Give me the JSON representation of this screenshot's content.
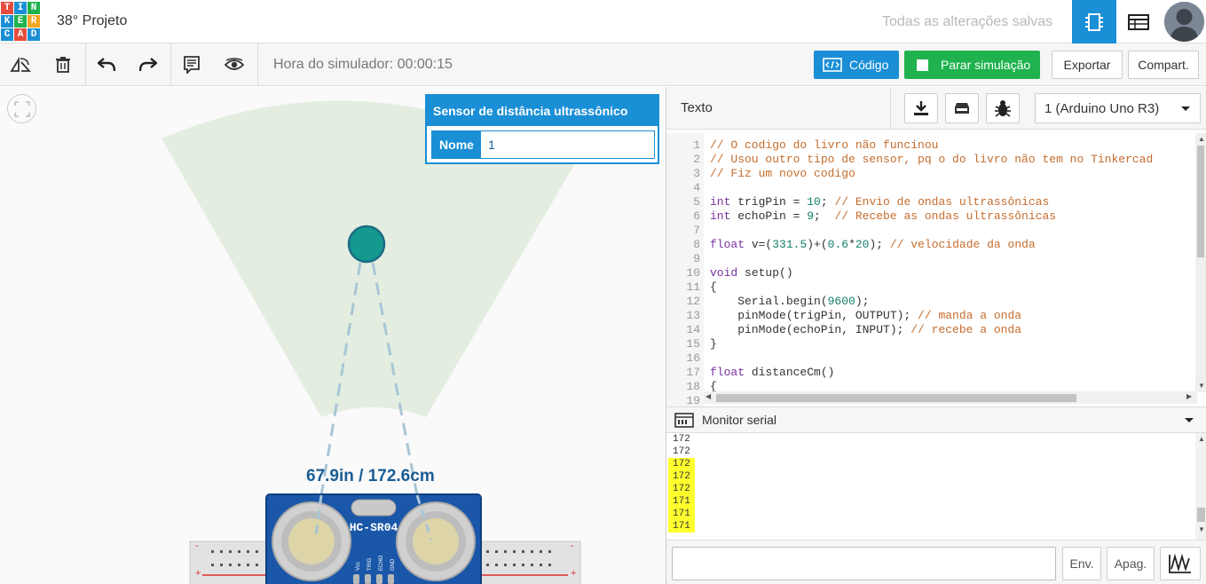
{
  "header": {
    "logo_letters": [
      "T",
      "I",
      "N",
      "K",
      "E",
      "R",
      "C",
      "A",
      "D"
    ],
    "project_title": "38° Projeto",
    "save_status": "Todas as alterações salvas",
    "circuit_view_icon": "circuit-chip-icon",
    "list_view_icon": "component-list-icon"
  },
  "toolbar": {
    "rotate_icon": "rotate-icon",
    "delete_icon": "trash-icon",
    "undo_icon": "undo-icon",
    "redo_icon": "redo-icon",
    "notes_icon": "notes-icon",
    "visibility_icon": "eye-icon",
    "simulator_time": "Hora do simulador: 00:00:15",
    "code_label": "Código",
    "stop_sim_label": "Parar simulação",
    "export_label": "Exportar",
    "share_label": "Compart."
  },
  "canvas": {
    "distance_readout": "67.9in / 172.6cm",
    "sensor_label": "HC-SR04",
    "pin_labels": [
      "Vcc",
      "TRIG",
      "ECHO",
      "GND"
    ],
    "inspector": {
      "title": "Sensor de distância ultrassônico",
      "name_label": "Nome",
      "name_value": "1"
    }
  },
  "code_panel": {
    "mode_label": "Texto",
    "download_icon": "download-icon",
    "library_icon": "library-icon",
    "debug_icon": "bug-icon",
    "board_selected": "1 (Arduino Uno R3)",
    "lines": [
      {
        "n": "1",
        "parts": [
          {
            "c": "cm",
            "t": "// O codigo do livro não funcinou"
          }
        ]
      },
      {
        "n": "2",
        "parts": [
          {
            "c": "cm",
            "t": "// Usou outro tipo de sensor, pq o do livro não tem no Tinkercad"
          }
        ]
      },
      {
        "n": "3",
        "parts": [
          {
            "c": "cm",
            "t": "// Fiz um novo codigo"
          }
        ]
      },
      {
        "n": "4",
        "parts": []
      },
      {
        "n": "5",
        "parts": [
          {
            "c": "kw",
            "t": "int"
          },
          {
            "c": "",
            "t": " trigPin = "
          },
          {
            "c": "nm",
            "t": "10"
          },
          {
            "c": "",
            "t": "; "
          },
          {
            "c": "cm",
            "t": "// Envio de ondas ultrassônicas"
          }
        ]
      },
      {
        "n": "6",
        "parts": [
          {
            "c": "kw",
            "t": "int"
          },
          {
            "c": "",
            "t": " echoPin = "
          },
          {
            "c": "nm",
            "t": "9"
          },
          {
            "c": "",
            "t": ";  "
          },
          {
            "c": "cm",
            "t": "// Recebe as ondas ultrassônicas"
          }
        ]
      },
      {
        "n": "7",
        "parts": []
      },
      {
        "n": "8",
        "parts": [
          {
            "c": "kw",
            "t": "float"
          },
          {
            "c": "",
            "t": " v=("
          },
          {
            "c": "nm",
            "t": "331.5"
          },
          {
            "c": "",
            "t": ")+("
          },
          {
            "c": "nm",
            "t": "0.6"
          },
          {
            "c": "",
            "t": "*"
          },
          {
            "c": "nm",
            "t": "20"
          },
          {
            "c": "",
            "t": "); "
          },
          {
            "c": "cm",
            "t": "// velocidade da onda"
          }
        ]
      },
      {
        "n": "9",
        "parts": []
      },
      {
        "n": "10",
        "parts": [
          {
            "c": "kw",
            "t": "void"
          },
          {
            "c": "",
            "t": " setup()"
          }
        ]
      },
      {
        "n": "11",
        "parts": [
          {
            "c": "",
            "t": "{"
          }
        ]
      },
      {
        "n": "12",
        "parts": [
          {
            "c": "",
            "t": "    Serial.begin("
          },
          {
            "c": "nm",
            "t": "9600"
          },
          {
            "c": "",
            "t": ");"
          }
        ]
      },
      {
        "n": "13",
        "parts": [
          {
            "c": "",
            "t": "    pinMode(trigPin, OUTPUT); "
          },
          {
            "c": "cm",
            "t": "// manda a onda"
          }
        ]
      },
      {
        "n": "14",
        "parts": [
          {
            "c": "",
            "t": "    pinMode(echoPin, INPUT); "
          },
          {
            "c": "cm",
            "t": "// recebe a onda"
          }
        ]
      },
      {
        "n": "15",
        "parts": [
          {
            "c": "",
            "t": "}"
          }
        ]
      },
      {
        "n": "16",
        "parts": []
      },
      {
        "n": "17",
        "parts": [
          {
            "c": "kw",
            "t": "float"
          },
          {
            "c": "",
            "t": " distanceCm()"
          }
        ]
      },
      {
        "n": "18",
        "parts": [
          {
            "c": "",
            "t": "{"
          }
        ]
      },
      {
        "n": "19",
        "parts": []
      }
    ],
    "serial_monitor_title": "Monitor serial",
    "serial_lines": [
      {
        "t": "172",
        "hl": false
      },
      {
        "t": "172",
        "hl": false
      },
      {
        "t": "172",
        "hl": true
      },
      {
        "t": "172",
        "hl": true
      },
      {
        "t": "172",
        "hl": true
      },
      {
        "t": "171",
        "hl": true
      },
      {
        "t": "171",
        "hl": true
      },
      {
        "t": "171",
        "hl": true
      }
    ],
    "send_label": "Env.",
    "clear_label": "Apag.",
    "graph_icon": "waveform-icon"
  },
  "colors": {
    "accent_blue": "#1a8fd6",
    "sim_green": "#1fb24e",
    "highlight_yellow": "#ffff2e",
    "logo": [
      "#e64c3c",
      "#1a8fd6",
      "#1fb24e",
      "#f4a622"
    ]
  }
}
